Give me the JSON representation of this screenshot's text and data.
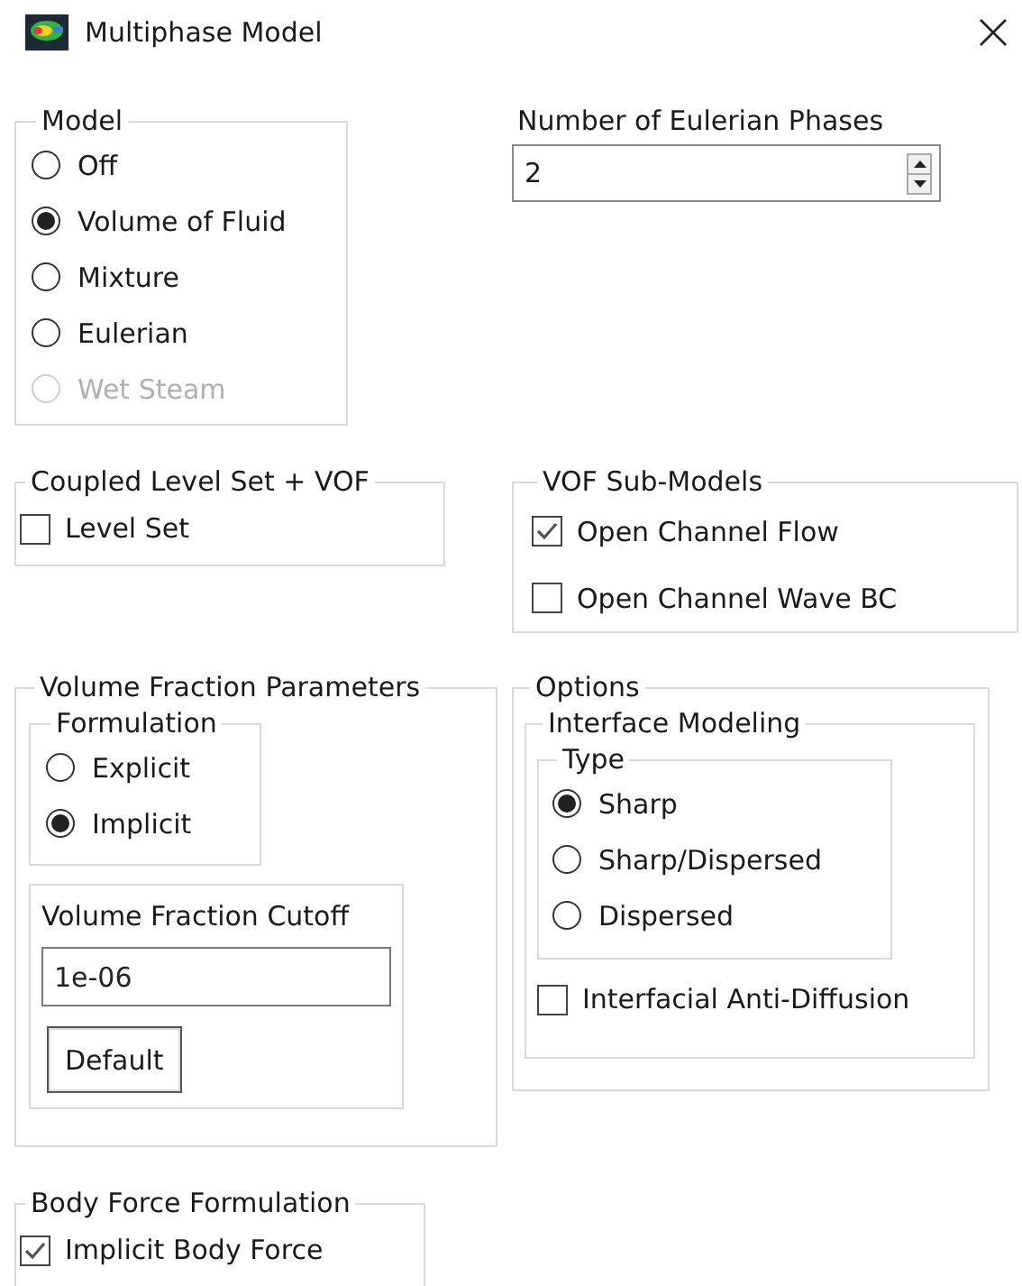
{
  "window": {
    "title": "Multiphase Model"
  },
  "model": {
    "legend": "Model",
    "options": [
      {
        "label": "Off",
        "selected": false,
        "disabled": false
      },
      {
        "label": "Volume of Fluid",
        "selected": true,
        "disabled": false
      },
      {
        "label": "Mixture",
        "selected": false,
        "disabled": false
      },
      {
        "label": "Eulerian",
        "selected": false,
        "disabled": false
      },
      {
        "label": "Wet Steam",
        "selected": false,
        "disabled": true
      }
    ]
  },
  "eulerian_phases": {
    "label": "Number of Eulerian Phases",
    "value": "2"
  },
  "coupled_level_set": {
    "legend": "Coupled Level Set + VOF",
    "options": [
      {
        "label": "Level Set",
        "checked": false
      }
    ]
  },
  "vof_sub_models": {
    "legend": "VOF Sub-Models",
    "options": [
      {
        "label": "Open Channel Flow",
        "checked": true
      },
      {
        "label": "Open Channel Wave BC",
        "checked": false
      }
    ]
  },
  "volume_fraction_parameters": {
    "legend": "Volume Fraction Parameters",
    "formulation": {
      "legend": "Formulation",
      "options": [
        {
          "label": "Explicit",
          "selected": false
        },
        {
          "label": "Implicit",
          "selected": true
        }
      ]
    },
    "cutoff": {
      "label": "Volume Fraction Cutoff",
      "value": "1e-06",
      "button": "Default"
    }
  },
  "options": {
    "legend": "Options",
    "interface_modeling": {
      "legend": "Interface Modeling",
      "type": {
        "legend": "Type",
        "options": [
          {
            "label": "Sharp",
            "selected": true
          },
          {
            "label": "Sharp/Dispersed",
            "selected": false
          },
          {
            "label": "Dispersed",
            "selected": false
          }
        ]
      },
      "checkboxes": [
        {
          "label": "Interfacial Anti-Diffusion",
          "checked": false
        }
      ]
    }
  },
  "body_force": {
    "legend": "Body Force Formulation",
    "options": [
      {
        "label": "Implicit Body Force",
        "checked": true
      }
    ]
  }
}
